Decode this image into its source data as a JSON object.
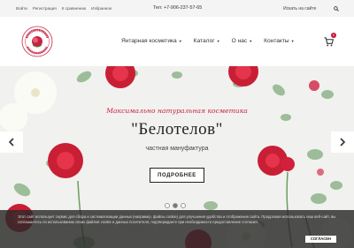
{
  "topbar": {
    "links": [
      "Войти",
      "Регистрация",
      "К сравнению",
      "Избранное"
    ],
    "phone": "Тел: +7-906-237-57-65",
    "search_placeholder": "Искать на сайте"
  },
  "logo": {
    "top_text": "Мануфактура",
    "bottom_text": "Белотелов"
  },
  "nav": {
    "items": [
      "Янтарная косметика",
      "Каталог",
      "О нас",
      "Контакты"
    ]
  },
  "cart": {
    "count": "0"
  },
  "hero": {
    "slogan": "Максимально натуральная косметика",
    "title": "\"Белотелов\"",
    "subtitle": "частная мануфактура",
    "button": "ПОДРОБНЕЕ",
    "slides": 3,
    "active_slide": 1
  },
  "cookie": {
    "text": "Этот сайт использует сервис для сбора и систематизации данных (например, файлы cookie) для улучшения удобства и отображения сайта. Продолжая использовать наш веб-сайт, вы соглашаетесь по использованию своих файлов cookie и данных посетителя, подтверждаете при необходимости предоставление согласия.",
    "button": "СОГЛАСЕН"
  },
  "colors": {
    "accent": "#c62242",
    "badge": "#c8102e"
  }
}
